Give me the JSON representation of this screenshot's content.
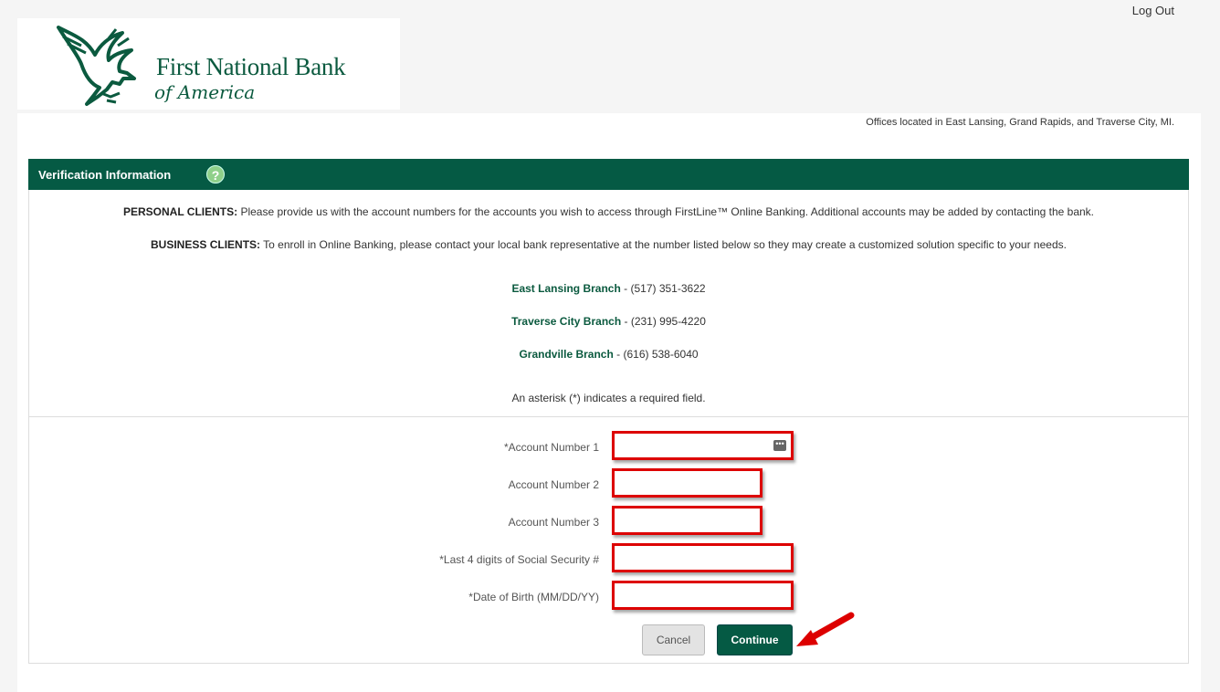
{
  "header": {
    "bank_name": "First National Bank",
    "bank_subtitle": "of America",
    "logout_label": "Log Out"
  },
  "offices_text": "Offices located in East Lansing, Grand Rapids, and Traverse City, MI.",
  "section": {
    "title": "Verification Information",
    "help_icon": "?"
  },
  "info": {
    "personal_label": "PERSONAL CLIENTS:",
    "personal_text": " Please provide us with the account numbers for the accounts you wish to access through FirstLine™ Online Banking. Additional accounts may be added by contacting the bank.",
    "business_label": "BUSINESS CLIENTS:",
    "business_text": " To enroll in Online Banking, please contact your local bank representative at the number listed below so they may create a customized solution specific to your needs.",
    "required_note": "An asterisk (*) indicates a required field."
  },
  "branches": [
    {
      "name": "East Lansing Branch",
      "phone": " - (517) 351-3622"
    },
    {
      "name": "Traverse City Branch",
      "phone": " - (231) 995-4220"
    },
    {
      "name": "Grandville Branch",
      "phone": " - (616) 538-6040"
    }
  ],
  "form": {
    "fields": [
      {
        "label": "*Account Number 1",
        "value": ""
      },
      {
        "label": "Account Number 2",
        "value": ""
      },
      {
        "label": "Account Number 3",
        "value": ""
      },
      {
        "label": "*Last 4 digits of Social Security #",
        "value": ""
      },
      {
        "label": "*Date of Birth (MM/DD/YY)",
        "value": ""
      }
    ],
    "cancel_label": "Cancel",
    "continue_label": "Continue"
  },
  "colors": {
    "brand_green": "#055a44",
    "highlight_red": "#dd0000"
  }
}
